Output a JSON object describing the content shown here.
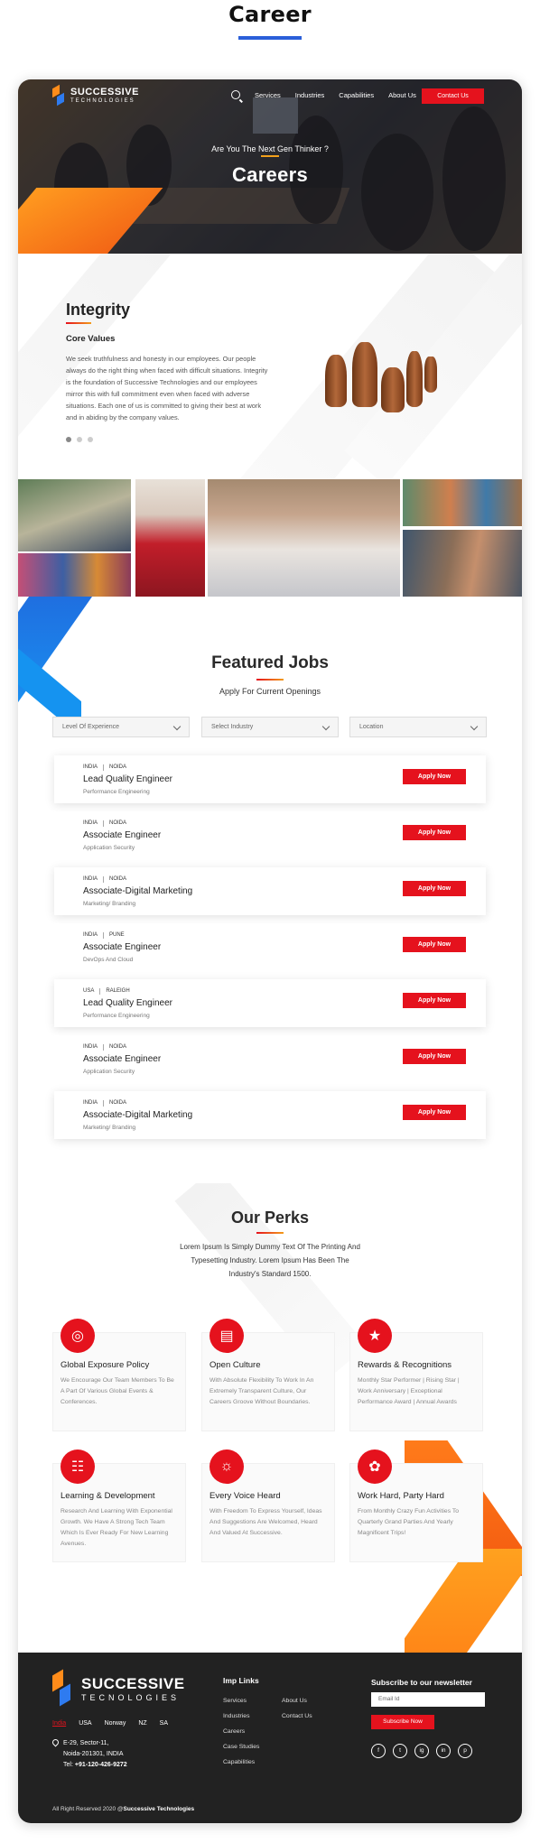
{
  "page_title": "Career",
  "header": {
    "brand_line1": "SUCCESSIVE",
    "brand_line2": "TECHNOLOGIES",
    "nav": [
      "Services",
      "Industries",
      "Capabilities",
      "About Us"
    ],
    "contact_label": "Contact Us",
    "subtitle": "Are You The Next Gen Thinker ?",
    "title": "Careers"
  },
  "values": {
    "title": "Integrity",
    "subtitle": "Core Values",
    "body": "We seek truthfulness and honesty in our employees. Our people always do the right thing when faced with difficult situations. Integrity is the foundation of Successive Technologies and our employees mirror this with full commitment even when faced with adverse situations. Each one of us is committed to giving their best at work and in abiding by the company values."
  },
  "jobs": {
    "title": "Featured Jobs",
    "subtitle": "Apply For Current Openings",
    "filters": [
      "Level Of Experience",
      "Select Industry",
      "Location"
    ],
    "apply_label": "Apply Now",
    "list": [
      {
        "country": "INDIA",
        "city": "NOIDA",
        "title": "Lead Quality Engineer",
        "dept": "Performance Engineering"
      },
      {
        "country": "INDIA",
        "city": "NOIDA",
        "title": "Associate Engineer",
        "dept": "Application Security"
      },
      {
        "country": "INDIA",
        "city": "NOIDA",
        "title": "Associate-Digital Marketing",
        "dept": "Marketing/ Branding"
      },
      {
        "country": "INDIA",
        "city": "PUNE",
        "title": "Associate Engineer",
        "dept": "DevOps And Cloud"
      },
      {
        "country": "USA",
        "city": "RALEIGH",
        "title": "Lead Quality Engineer",
        "dept": "Performance Engineering"
      },
      {
        "country": "INDIA",
        "city": "NOIDA",
        "title": "Associate Engineer",
        "dept": "Application Security"
      },
      {
        "country": "INDIA",
        "city": "NOIDA",
        "title": "Associate-Digital Marketing",
        "dept": "Marketing/ Branding"
      }
    ]
  },
  "perks": {
    "title": "Our Perks",
    "intro": "Lorem Ipsum Is Simply Dummy Text Of The Printing And Typesetting Industry. Lorem Ipsum Has Been The Industry's Standard 1500.",
    "items": [
      {
        "icon": "globe-icon",
        "title": "Global Exposure Policy",
        "text": "We Encourage Our Team Members To Be A Part Of Various Global Events & Conferences."
      },
      {
        "icon": "chart-icon",
        "title": "Open Culture",
        "text": "With Absolute Flexibility To Work In An Extremely Transparent Culture, Our Careers Groove Without Boundaries."
      },
      {
        "icon": "trophy-icon",
        "title": "Rewards & Recognitions",
        "text": "Monthly Star Performer | Rising Star | Work Anniversary | Exceptional Performance Award | Annual Awards"
      },
      {
        "icon": "book-icon",
        "title": "Learning & Development",
        "text": "Research And Learning With Exponential Growth. We Have A Strong Tech Team Which Is Ever Ready For New Learning Avenues."
      },
      {
        "icon": "bulb-icon",
        "title": "Every Voice Heard",
        "text": "With Freedom To Express Yourself, Ideas And Suggestions Are Welcomed, Heard And Valued At Successive."
      },
      {
        "icon": "party-icon",
        "title": "Work Hard, Party Hard",
        "text": "From Monthly Crazy Fun Activities To Quarterly Grand Parties And Yearly Magnificent Trips!"
      }
    ]
  },
  "footer": {
    "brand_line1": "SUCCESSIVE",
    "brand_line2": "TECNOLOGIES",
    "countries": [
      "India",
      "USA",
      "Norway",
      "NZ",
      "SA"
    ],
    "address_line1": "E-29, Sector-11,",
    "address_line2": "Noida-201301, INDIA",
    "tel_label": "Tel:",
    "tel": "+91-120-426-9272",
    "links_title": "Imp Links",
    "links_col1": [
      "Services",
      "Industries",
      "Careers",
      "Case Studies",
      "Capabilities"
    ],
    "links_col2": [
      "About Us",
      "Contact Us"
    ],
    "subscribe_title": "Subscribe to our newsletter",
    "email_placeholder": "Email Id",
    "subscribe_label": "Subscribe Now",
    "social": [
      "f",
      "t",
      "ig",
      "in",
      "p"
    ],
    "copyright_prefix": "All Right Reserved 2020 @",
    "copyright_brand": "Successive Technologies"
  },
  "colors": {
    "accent_red": "#e5121d",
    "accent_blue": "#2b5fd9",
    "accent_orange": "#f39c1b"
  }
}
